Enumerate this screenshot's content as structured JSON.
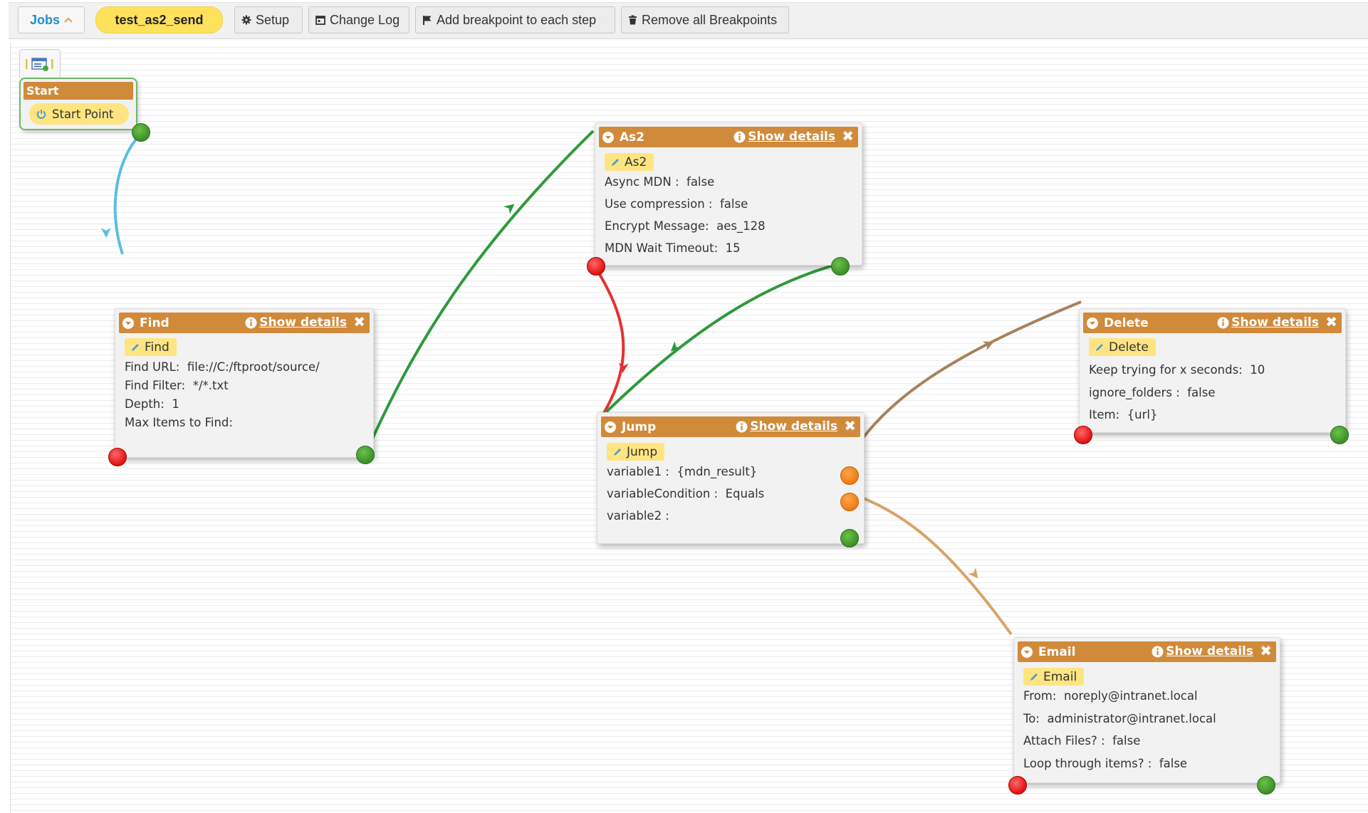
{
  "toolbar": {
    "jobs_label": "Jobs",
    "job_name": "test_as2_send",
    "setup_label": "Setup",
    "changelog_label": "Change Log",
    "add_breakpoint_label": "Add breakpoint to each step",
    "remove_breakpoints_label": "Remove all Breakpoints"
  },
  "start": {
    "title": "Start",
    "point_label": "Start Point"
  },
  "show_details": "Show details",
  "nodes": {
    "find": {
      "title": "Find",
      "chip": "Find",
      "props": [
        {
          "key": "Find URL:",
          "value": "file://C:/ftproot/source/"
        },
        {
          "key": "Find Filter:",
          "value": "*/*.txt"
        },
        {
          "key": "Depth:",
          "value": "1"
        },
        {
          "key": "Max Items to Find:",
          "value": ""
        }
      ]
    },
    "as2": {
      "title": "As2",
      "chip": "As2",
      "props": [
        {
          "key": "Async MDN :",
          "value": "false"
        },
        {
          "key": "Use compression :",
          "value": "false"
        },
        {
          "key": "Encrypt Message:",
          "value": "aes_128"
        },
        {
          "key": "MDN Wait Timeout:",
          "value": "15"
        }
      ]
    },
    "jump": {
      "title": "Jump",
      "chip": "Jump",
      "props": [
        {
          "key": "variable1 :",
          "value": "{mdn_result}"
        },
        {
          "key": "variableCondition :",
          "value": "Equals"
        },
        {
          "key": "variable2 :",
          "value": ""
        }
      ]
    },
    "delete": {
      "title": "Delete",
      "chip": "Delete",
      "props": [
        {
          "key": "Keep trying for x seconds:",
          "value": "10"
        },
        {
          "key": "ignore_folders :",
          "value": "false"
        },
        {
          "key": "Item:",
          "value": "{url}"
        }
      ]
    },
    "email": {
      "title": "Email",
      "chip": "Email",
      "props": [
        {
          "key": "From:",
          "value": "noreply@intranet.local"
        },
        {
          "key": "To:",
          "value": "administrator@intranet.local"
        },
        {
          "key": "Attach Files? :",
          "value": "false"
        },
        {
          "key": "Loop through items? :",
          "value": "false"
        }
      ]
    }
  },
  "colors": {
    "header": "#d08a3a",
    "chip": "#ffe581",
    "job_name_bg": "#ffe25c",
    "edge_start": "#5bbde4",
    "edge_success": "#2e9a3a",
    "edge_failure": "#e83030",
    "edge_jump_true": "#a8825c",
    "edge_jump_false": "#d9a36a"
  }
}
